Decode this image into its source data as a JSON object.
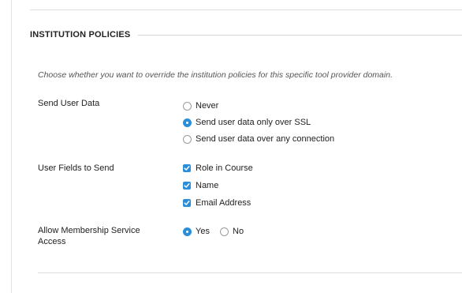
{
  "section": {
    "title": "INSTITUTION POLICIES",
    "instructions": "Choose whether you want to override the institution policies for this specific tool provider domain."
  },
  "send_user_data": {
    "label": "Send User Data",
    "options": [
      {
        "label": "Never",
        "checked": false
      },
      {
        "label": "Send user data only over SSL",
        "checked": true
      },
      {
        "label": "Send user data over any connection",
        "checked": false
      }
    ]
  },
  "user_fields": {
    "label": "User Fields to Send",
    "options": [
      {
        "label": "Role in Course",
        "checked": true
      },
      {
        "label": "Name",
        "checked": true
      },
      {
        "label": "Email Address",
        "checked": true
      }
    ]
  },
  "membership": {
    "label_line1": "Allow Membership Service",
    "label_line2": "Access",
    "options": [
      {
        "label": "Yes",
        "checked": true
      },
      {
        "label": "No",
        "checked": false
      }
    ]
  },
  "colors": {
    "accent": "#2a8fd8",
    "rule": "#dddddd"
  }
}
